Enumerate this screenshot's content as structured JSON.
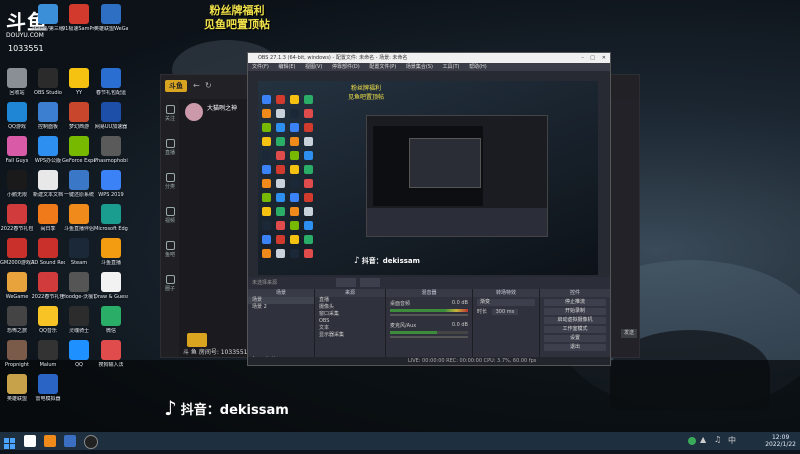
{
  "overlay": {
    "logo_text": "斗鱼",
    "logo_url": "DOUYU.COM",
    "room_id": "1033551",
    "fan_banner_line1": "粉丝牌福利",
    "fan_banner_line2": "见鱼吧置顶帖"
  },
  "desktop_icons": [
    {
      "label": "回收站",
      "color": "#c9d2da"
    },
    {
      "label": "此电脑/第三组",
      "color": "#3b8fd9"
    },
    {
      "label": "91极速SamPro机器",
      "color": "#d13a2d"
    },
    {
      "label": "英雄联盟WeGame版",
      "color": "#2e6fc4"
    },
    {
      "label": "回收站",
      "color": "#8a8f96"
    },
    {
      "label": "OBS Studio",
      "color": "#2b2b2b"
    },
    {
      "label": "YY",
      "color": "#f5c211"
    },
    {
      "label": "春节礼包配运",
      "color": "#2a6ed1"
    },
    {
      "label": "QQ游戏",
      "color": "#1f86d6"
    },
    {
      "label": "控制面板",
      "color": "#3c7fd0"
    },
    {
      "label": "梦幻西游",
      "color": "#c8462c"
    },
    {
      "label": "网易UU加速器",
      "color": "#1d4fa8"
    },
    {
      "label": "Fall Guys",
      "color": "#d95ba8"
    },
    {
      "label": "WPS办公版",
      "color": "#2d8ff0"
    },
    {
      "label": "GeForce Experience",
      "color": "#76b900"
    },
    {
      "label": "Phasmophobia",
      "color": "#5a5a5a"
    },
    {
      "label": "小鹅无限",
      "color": "#1a1a1a"
    },
    {
      "label": "新建文本文档",
      "color": "#e8e8e8"
    },
    {
      "label": "一键还原系统",
      "color": "#3a77c7"
    },
    {
      "label": "WPS 2019",
      "color": "#3b82f6"
    },
    {
      "label": "2022春节礼包",
      "color": "#d23b3b"
    },
    {
      "label": "闹日季",
      "color": "#f07a1a"
    },
    {
      "label": "斗鱼直播伴侣",
      "color": "#f08a1a"
    },
    {
      "label": "Microsoft Edge",
      "color": "#1a9d8f"
    },
    {
      "label": "GM2000游戏工具",
      "color": "#c9302c"
    },
    {
      "label": "AD Sound Recorder",
      "color": "#c9302c"
    },
    {
      "label": "Steam",
      "color": "#1b2838"
    },
    {
      "label": "斗鱼直播",
      "color": "#f39c12"
    },
    {
      "label": "WeGame",
      "color": "#e8a33d"
    },
    {
      "label": "2022春节礼包",
      "color": "#d23b3b"
    },
    {
      "label": "Hoodge-沃檀艺术",
      "color": "#555"
    },
    {
      "label": "Draw & Guess",
      "color": "#f2f2f2"
    },
    {
      "label": "恐怖之旅",
      "color": "#444"
    },
    {
      "label": "QQ音乐",
      "color": "#f7c325"
    },
    {
      "label": "灵魂骑士",
      "color": "#2c2c2c"
    },
    {
      "label": "微信",
      "color": "#2aae67"
    },
    {
      "label": "Propnight",
      "color": "#7a5b4a"
    },
    {
      "label": "Malum",
      "color": "#333"
    },
    {
      "label": "QQ",
      "color": "#1e90ff"
    },
    {
      "label": "搜狗输入法",
      "color": "#e04b4b"
    },
    {
      "label": "英雄联盟",
      "color": "#c8a24a"
    },
    {
      "label": "雷电模拟器",
      "color": "#2a64c4"
    }
  ],
  "douyu_window": {
    "streamer_name": "大猫咧之神",
    "room_label": "斗 鱼 房间号: 1033551",
    "sidebar": [
      "关注",
      "直播",
      "分类",
      "视频",
      "鱼吧",
      "圈子"
    ],
    "send_label": "发送"
  },
  "obs": {
    "title": "OBS 27.1.3 (64-bit, windows) - 配置文件: 未命名 - 场景: 未命名",
    "menu": [
      "文件(F)",
      "编辑(E)",
      "视图(V)",
      "停靠部件(D)",
      "配置文件(P)",
      "场景集合(S)",
      "工具(T)",
      "帮助(H)"
    ],
    "overlay_banner1": "粉丝牌福利",
    "overlay_banner2": "见鱼吧置顶帖",
    "scenes_title": "场景",
    "scenes": [
      "场景",
      "场景 2"
    ],
    "sources_title": "来源",
    "sources": [
      "直播",
      "摄像头",
      "窗口采集",
      "OBS",
      "文本",
      "显示器采集"
    ],
    "mixer_title": "混音器",
    "mixer_tracks": [
      {
        "name": "桌面音频",
        "db": "0.0 dB"
      },
      {
        "name": "麦克风/Aux",
        "db": "0.0 dB"
      }
    ],
    "transitions_title": "转场特效",
    "transition_type": "渐变",
    "duration_label": "时长",
    "duration_value": "300 ms",
    "controls_title": "控件",
    "controls": [
      "停止推流",
      "开始录制",
      "启动虚拟摄像机",
      "工作室模式",
      "设置",
      "退出"
    ],
    "status": "LIVE: 00:00:00   REC: 00:00:00   CPU: 3.7%, 60.00 fps",
    "no_source": "未选择来源"
  },
  "tiktok": {
    "watermark": "抖音：dekissam",
    "inner_watermark": "抖音：dekissam"
  },
  "taskbar": {
    "time": "12:09",
    "date": "2022/1/22"
  }
}
